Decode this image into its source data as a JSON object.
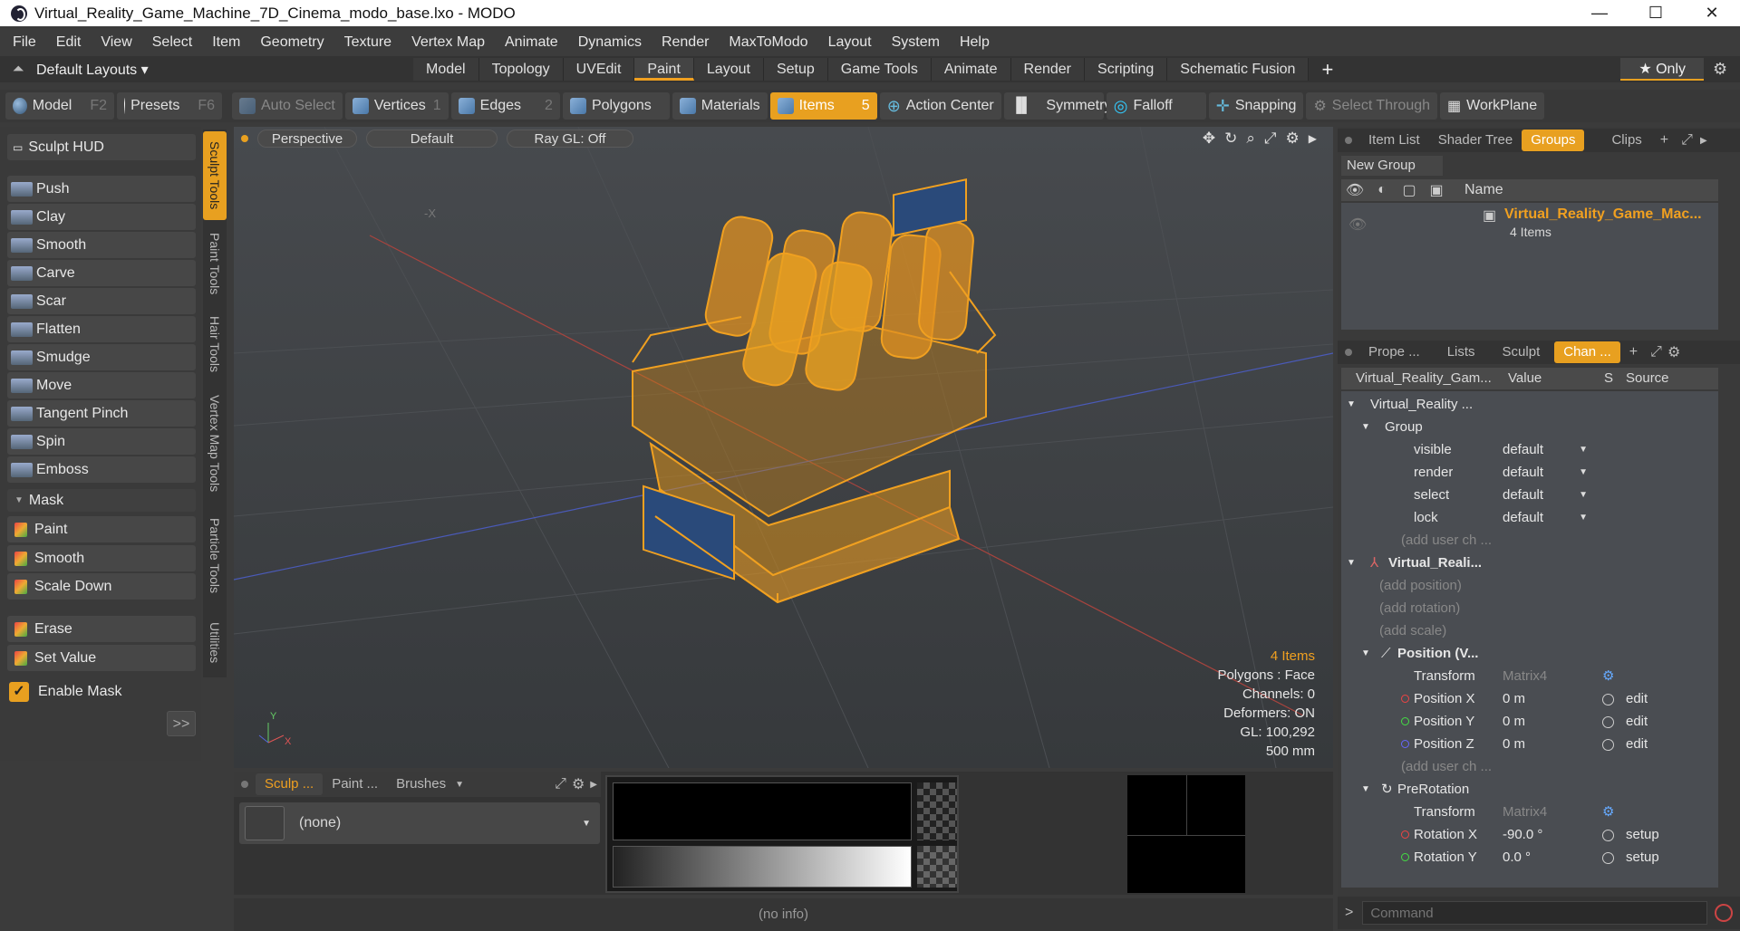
{
  "window": {
    "title": "Virtual_Reality_Game_Machine_7D_Cinema_modo_base.lxo - MODO",
    "minimize": "—",
    "maximize": "☐",
    "close": "✕"
  },
  "menu": [
    "File",
    "Edit",
    "View",
    "Select",
    "Item",
    "Geometry",
    "Texture",
    "Vertex Map",
    "Animate",
    "Dynamics",
    "Render",
    "MaxToModo",
    "Layout",
    "System",
    "Help"
  ],
  "layout_bar": {
    "layouts_label": "Default Layouts ▾",
    "tabs": [
      "Model",
      "Topology",
      "UVEdit",
      "Paint",
      "Layout",
      "Setup",
      "Game Tools",
      "Animate",
      "Render",
      "Scripting",
      "Schematic Fusion"
    ],
    "active_tab": "Paint",
    "add": "+",
    "only": "★  Only"
  },
  "toolbar": {
    "model": "Model",
    "model_key": "F2",
    "presets": "Presets",
    "presets_key": "F6",
    "auto_select": "Auto Select",
    "vertices": "Vertices",
    "vertices_num": "1",
    "edges": "Edges",
    "edges_num": "2",
    "polygons": "Polygons",
    "materials": "Materials",
    "items": "Items",
    "items_num": "5",
    "action_center": "Action Center",
    "symmetry": "Symmetry",
    "falloff": "Falloff",
    "snapping": "Snapping",
    "select_through": "Select Through",
    "workplane": "WorkPlane"
  },
  "sculpt": {
    "hud": "Sculpt HUD",
    "tools": [
      "Push",
      "Clay",
      "Smooth",
      "Carve",
      "Scar",
      "Flatten",
      "Smudge",
      "Move",
      "Tangent Pinch",
      "Spin",
      "Emboss"
    ],
    "mask_header": "Mask",
    "mask_tools": [
      "Paint",
      "Smooth",
      "Scale Down"
    ],
    "erase": "Erase",
    "set_value": "Set Value",
    "enable_mask": "Enable Mask",
    "more": ">>"
  },
  "vertical_tabs": [
    "Sculpt Tools",
    "Paint Tools",
    "Hair Tools",
    "Vertex Map Tools",
    "Particle Tools",
    "Utilities"
  ],
  "viewport": {
    "view": "Perspective",
    "shading": "Default",
    "raygl": "Ray GL: Off",
    "axis_marker": "-X",
    "stats": {
      "items": "4 Items",
      "polygons": "Polygons : Face",
      "channels": "Channels: 0",
      "deformers": "Deformers: ON",
      "gl": "GL: 100,292",
      "scale": "500 mm"
    }
  },
  "bottom": {
    "tabs": [
      "Sculp ...",
      "Paint ...",
      "Brushes"
    ],
    "brush": "(none)",
    "status": "(no info)"
  },
  "groups_panel": {
    "tabs": [
      "Item List",
      "Shader Tree",
      "Groups",
      "Clips"
    ],
    "active": "Groups",
    "new_group": "New Group",
    "col_name": "Name",
    "group_name": "Virtual_Reality_Game_Mac...",
    "group_count": "4 Items"
  },
  "channels_panel": {
    "tabs": [
      "Prope ...",
      "Lists",
      "Sculpt",
      "Chan ..."
    ],
    "active": "Chan ...",
    "headers": [
      "Virtual_Reality_Gam...",
      "Value",
      "S",
      "Source"
    ],
    "rows": [
      {
        "name": "Virtual_Reality ...",
        "value": "",
        "source": ""
      },
      {
        "name": "Group",
        "value": "",
        "source": ""
      },
      {
        "name": "visible",
        "value": "default",
        "source": ""
      },
      {
        "name": "render",
        "value": "default",
        "source": ""
      },
      {
        "name": "select",
        "value": "default",
        "source": ""
      },
      {
        "name": "lock",
        "value": "default",
        "source": ""
      },
      {
        "name": "(add user ch ...",
        "value": "",
        "source": ""
      },
      {
        "name": "Virtual_Reali...",
        "value": "",
        "source": ""
      },
      {
        "name": "(add position)",
        "value": "",
        "source": ""
      },
      {
        "name": "(add rotation)",
        "value": "",
        "source": ""
      },
      {
        "name": "(add scale)",
        "value": "",
        "source": ""
      },
      {
        "name": "Position (V...",
        "value": "",
        "source": ""
      },
      {
        "name": "Transform",
        "value": "Matrix4",
        "source": ""
      },
      {
        "name": "Position X",
        "value": "0 m",
        "source": "edit"
      },
      {
        "name": "Position Y",
        "value": "0 m",
        "source": "edit"
      },
      {
        "name": "Position Z",
        "value": "0 m",
        "source": "edit"
      },
      {
        "name": "(add user ch ...",
        "value": "",
        "source": ""
      },
      {
        "name": "PreRotation",
        "value": "",
        "source": ""
      },
      {
        "name": "Transform",
        "value": "Matrix4",
        "source": ""
      },
      {
        "name": "Rotation X",
        "value": "-90.0 °",
        "source": "setup"
      },
      {
        "name": "Rotation Y",
        "value": "0.0 °",
        "source": "setup"
      }
    ]
  },
  "command": {
    "placeholder": "Command",
    "prompt": ">"
  }
}
